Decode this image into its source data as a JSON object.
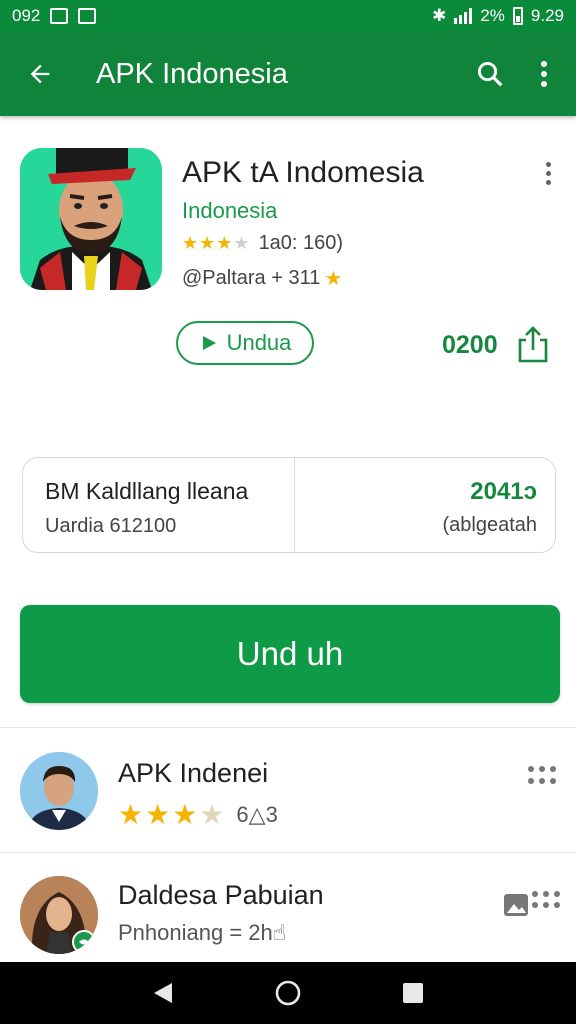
{
  "status_bar": {
    "left_text": "092",
    "battery_text": "2%",
    "time": "9.29"
  },
  "app_bar": {
    "title": "APK Indonesia",
    "back_icon": "arrow-left-icon",
    "search_icon": "search-icon",
    "more_icon": "more-vert-icon"
  },
  "app": {
    "name": "APK tA Indomesia",
    "developer": "Indonesia",
    "rating_text": "1a0: 160)",
    "rating_stars": 3.5,
    "meta_text": "@Paltara + 311",
    "chip_label": "Undua",
    "count_value": "0200"
  },
  "info_card": {
    "title": "BM Kaldllang lleana",
    "subtitle": "Uardia 612100",
    "value": "2041ɔ",
    "label": "(ablgeatah"
  },
  "install_button": {
    "label": "Und uh"
  },
  "list": [
    {
      "title": "APK Indenei",
      "rating_stars": 3.5,
      "meta": "6△3"
    },
    {
      "title": "Daldesa Pabuian",
      "rating_stars": 3.5,
      "meta": "Pnhoniang = 2h☝"
    }
  ],
  "colors": {
    "brand_green": "#11843c",
    "accent_green": "#0f9a48",
    "star": "#f5b400"
  }
}
